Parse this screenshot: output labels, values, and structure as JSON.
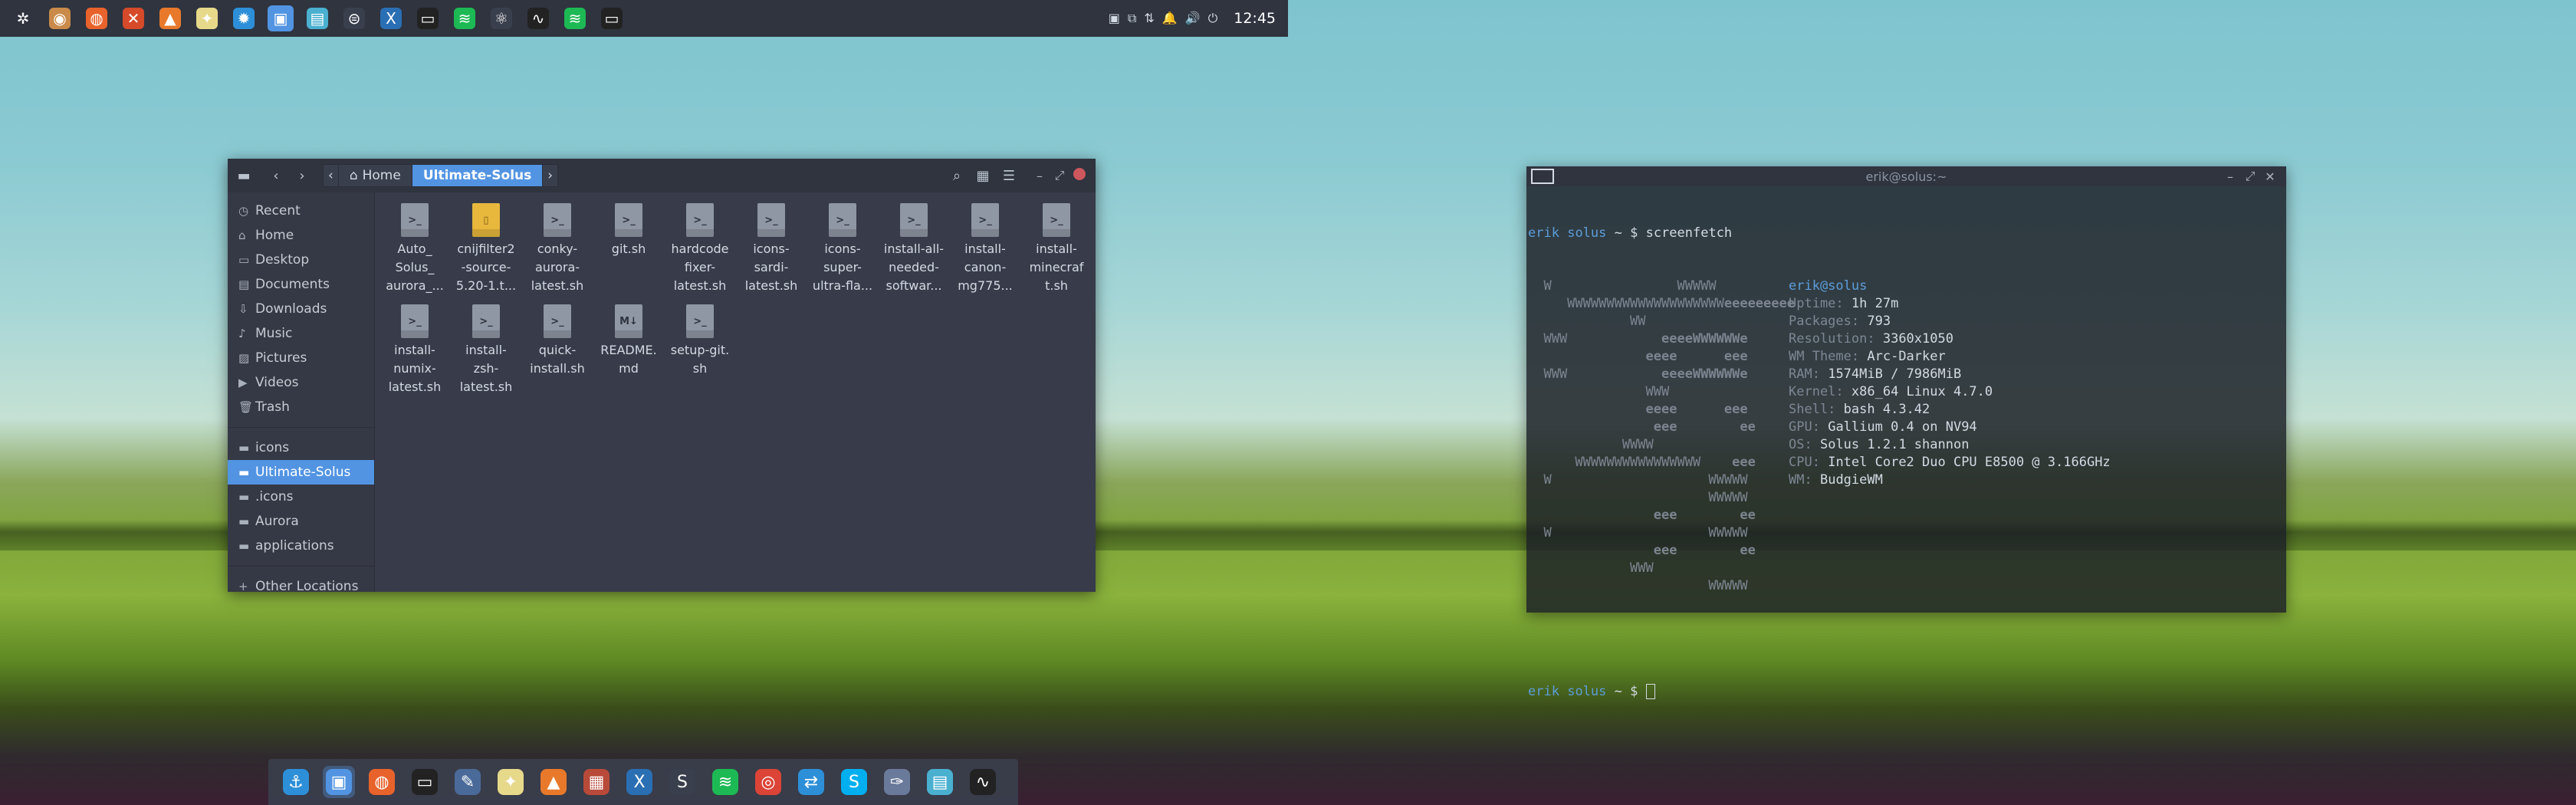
{
  "top_panel": {
    "icons": [
      {
        "name": "gnome-logo-icon",
        "glyph": "✲",
        "bg": "transparent"
      },
      {
        "name": "rhythmbox-icon",
        "glyph": "◉",
        "bg": "#c98a4a"
      },
      {
        "name": "firefox-icon",
        "glyph": "◍",
        "bg": "#e8632b"
      },
      {
        "name": "crossover-icon",
        "glyph": "✕",
        "bg": "#d64a2a"
      },
      {
        "name": "vlc-icon",
        "glyph": "▲",
        "bg": "#e8792b"
      },
      {
        "name": "lamp-icon",
        "glyph": "✦",
        "bg": "#e7d98a"
      },
      {
        "name": "settings-gear-icon",
        "glyph": "✹",
        "bg": "#2d8fd8"
      },
      {
        "name": "files-icon",
        "glyph": "▣",
        "bg": "#5294e2"
      },
      {
        "name": "image-viewer-icon",
        "glyph": "▤",
        "bg": "#4ab0d0"
      },
      {
        "name": "steam-icon",
        "glyph": "⊜",
        "bg": "#3a3f4d"
      },
      {
        "name": "xcode-like-icon",
        "glyph": "X",
        "bg": "#2a6fb3"
      },
      {
        "name": "terminal-icon",
        "glyph": "▭",
        "bg": "#222"
      },
      {
        "name": "spotify-icon",
        "glyph": "≋",
        "bg": "#1db954"
      },
      {
        "name": "atom-icon",
        "glyph": "⚛",
        "bg": "#3a3f4d"
      },
      {
        "name": "system-monitor-icon",
        "glyph": "∿",
        "bg": "#222"
      },
      {
        "name": "spotify-icon-2",
        "glyph": "≋",
        "bg": "#1db954"
      },
      {
        "name": "terminal-icon-2",
        "glyph": "▭",
        "bg": "#222"
      }
    ],
    "tray": [
      "▣",
      "⧉",
      "⇅",
      "🔔",
      "🔊",
      "⏻"
    ],
    "clock": "12:45"
  },
  "nautilus": {
    "breadcrumbs": [
      "Home",
      "Ultimate-Solus"
    ],
    "sidebar": {
      "places": [
        {
          "icon": "◷",
          "label": "Recent"
        },
        {
          "icon": "⌂",
          "label": "Home"
        },
        {
          "icon": "▭",
          "label": "Desktop"
        },
        {
          "icon": "▤",
          "label": "Documents"
        },
        {
          "icon": "⇩",
          "label": "Downloads"
        },
        {
          "icon": "♪",
          "label": "Music"
        },
        {
          "icon": "▨",
          "label": "Pictures"
        },
        {
          "icon": "▶",
          "label": "Videos"
        },
        {
          "icon": "🗑",
          "label": "Trash"
        }
      ],
      "bookmarks": [
        {
          "icon": "▬",
          "label": "icons"
        },
        {
          "icon": "▬",
          "label": "Ultimate-Solus"
        },
        {
          "icon": "▬",
          "label": ".icons"
        },
        {
          "icon": "▬",
          "label": "Aurora"
        },
        {
          "icon": "▬",
          "label": "applications"
        }
      ],
      "other": {
        "icon": "+",
        "label": "Other Locations"
      }
    },
    "files": [
      {
        "label": "Auto_\nSolus_\naurora_...",
        "type": "sh"
      },
      {
        "label": "cnijfilter2\n-source-\n5.20-1.t...",
        "type": "pkg"
      },
      {
        "label": "conky-\naurora-\nlatest.sh",
        "type": "sh"
      },
      {
        "label": "git.sh",
        "type": "sh"
      },
      {
        "label": "hardcode\nfixer-\nlatest.sh",
        "type": "sh"
      },
      {
        "label": "icons-\nsardi-\nlatest.sh",
        "type": "sh"
      },
      {
        "label": "icons-\nsuper-\nultra-fla...",
        "type": "sh"
      },
      {
        "label": "install-all-\nneeded-\nsoftwar...",
        "type": "sh"
      },
      {
        "label": "install-\ncanon-\nmg775...",
        "type": "sh"
      },
      {
        "label": "install-\nminecraf\nt.sh",
        "type": "sh"
      },
      {
        "label": "install-\nnumix-\nlatest.sh",
        "type": "sh"
      },
      {
        "label": "install-\nzsh-\nlatest.sh",
        "type": "sh"
      },
      {
        "label": "quick-\ninstall.sh",
        "type": "sh"
      },
      {
        "label": "README.\nmd",
        "type": "md"
      },
      {
        "label": "setup-git.\nsh",
        "type": "sh"
      }
    ]
  },
  "terminal": {
    "title": "erik@solus:~",
    "prompt_user": "erik",
    "prompt_host": "solus",
    "prompt_rest": " ~ $ ",
    "command": "screenfetch",
    "ascii": [
      "  W                WWWWW",
      "     WWWWWWWWWWWWWWWWWWWW",
      "             WW",
      "  WWW             ",
      "                ",
      "  WWW             ",
      "               WWW",
      "                ",
      "                 ",
      "            WWWW",
      "      WWWWWWWWWWWWWWWW",
      "  W                    WWWWW",
      "                       WWWWW",
      "                 ",
      "  W                    WWWWW",
      "                 ",
      "             WWW",
      "                       WWWWW"
    ],
    "ascii_bold": [
      "",
      "                         eeeeeeeee",
      "",
      "                 eeeeWWWWWWe",
      "               eeee      eee",
      "                 eeeeWWWWWWe",
      "",
      "               eeee      eee",
      "                eee        ee",
      "",
      "                          eee",
      "",
      "",
      "                eee        ee",
      "",
      "                eee        ee",
      "",
      ""
    ],
    "info": [
      {
        "label": "",
        "value": "erik@solus"
      },
      {
        "label": "Uptime:",
        "value": "1h 27m"
      },
      {
        "label": "Packages:",
        "value": "793"
      },
      {
        "label": "Resolution:",
        "value": "3360x1050"
      },
      {
        "label": "WM Theme:",
        "value": "Arc-Darker"
      },
      {
        "label": "RAM:",
        "value": "1574MiB / 7986MiB"
      },
      {
        "label": "Kernel:",
        "value": "x86_64 Linux 4.7.0"
      },
      {
        "label": "Shell:",
        "value": "bash 4.3.42"
      },
      {
        "label": "GPU:",
        "value": "Gallium 0.4 on NV94"
      },
      {
        "label": "OS:",
        "value": "Solus 1.2.1 shannon"
      },
      {
        "label": "CPU:",
        "value": "Intel Core2 Duo CPU E8500 @ 3.166GHz"
      },
      {
        "label": "WM:",
        "value": "BudgieWM"
      }
    ]
  },
  "dock": {
    "icons": [
      {
        "name": "anchor-icon",
        "glyph": "⚓",
        "bg": "#2d8fd8"
      },
      {
        "name": "files-dock-icon",
        "glyph": "▣",
        "bg": "#5294e2",
        "active": true
      },
      {
        "name": "firefox-dock-icon",
        "glyph": "◍",
        "bg": "#e8632b"
      },
      {
        "name": "terminal-dock-icon",
        "glyph": "▭",
        "bg": "#222"
      },
      {
        "name": "editor-dock-icon",
        "glyph": "✎",
        "bg": "#4a6a9a"
      },
      {
        "name": "lamp-dock-icon",
        "glyph": "✦",
        "bg": "#e7d98a"
      },
      {
        "name": "vlc-dock-icon",
        "glyph": "▲",
        "bg": "#e8792b"
      },
      {
        "name": "archive-dock-icon",
        "glyph": "▦",
        "bg": "#b84a3a"
      },
      {
        "name": "xcode-like-dock-icon",
        "glyph": "X",
        "bg": "#2a6fb3"
      },
      {
        "name": "steam-dock-icon",
        "glyph": "S",
        "bg": "#3a3f4d"
      },
      {
        "name": "spotify-dock-icon",
        "glyph": "≋",
        "bg": "#1db954"
      },
      {
        "name": "chrome-dock-icon",
        "glyph": "◎",
        "bg": "#db4437"
      },
      {
        "name": "remote-dock-icon",
        "glyph": "⇄",
        "bg": "#2d8fd8"
      },
      {
        "name": "skype-dock-icon",
        "glyph": "S",
        "bg": "#00aff0"
      },
      {
        "name": "feather-dock-icon",
        "glyph": "✑",
        "bg": "#6a7a9a"
      },
      {
        "name": "image-viewer-dock-icon",
        "glyph": "▤",
        "bg": "#4ab0d0"
      },
      {
        "name": "system-monitor-dock-icon",
        "glyph": "∿",
        "bg": "#222"
      }
    ]
  }
}
